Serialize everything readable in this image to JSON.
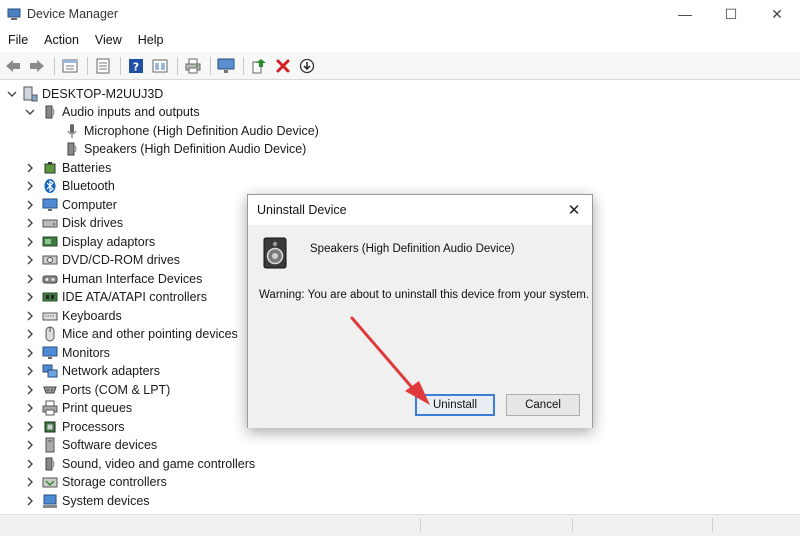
{
  "window": {
    "title": "Device Manager",
    "controls": {
      "minimize": "—",
      "maximize": "☐",
      "close": "✕"
    }
  },
  "menu": [
    "File",
    "Action",
    "View",
    "Help"
  ],
  "toolbar": {
    "icons": [
      "back-arrow-icon",
      "forward-arrow-icon",
      "properties-icon",
      "list-icon",
      "help-icon",
      "view-icon",
      "print-icon",
      "monitor-icon",
      "update-driver-icon",
      "uninstall-x-icon",
      "download-icon"
    ],
    "colors": {
      "help": "#1e4fa6",
      "uninstall": "#d32020",
      "update": "#2d8a2d"
    }
  },
  "tree": {
    "root": "DESKTOP-M2UUJ3D",
    "audio": {
      "label": "Audio inputs and outputs",
      "children": [
        "Microphone (High Definition Audio Device)",
        "Speakers (High Definition Audio Device)"
      ]
    },
    "categories": [
      "Batteries",
      "Bluetooth",
      "Computer",
      "Disk drives",
      "Display adaptors",
      "DVD/CD-ROM drives",
      "Human Interface Devices",
      "IDE ATA/ATAPI controllers",
      "Keyboards",
      "Mice and other pointing devices",
      "Monitors",
      "Network adapters",
      "Ports (COM & LPT)",
      "Print queues",
      "Processors",
      "Software devices",
      "Sound, video and game controllers",
      "Storage controllers",
      "System devices"
    ]
  },
  "dialog": {
    "title": "Uninstall Device",
    "close": "✕",
    "device_name": "Speakers (High Definition Audio Device)",
    "warning": "Warning: You are about to uninstall this device from your system.",
    "uninstall_label": "Uninstall",
    "cancel_label": "Cancel",
    "annotation_color": "#e0393b"
  }
}
